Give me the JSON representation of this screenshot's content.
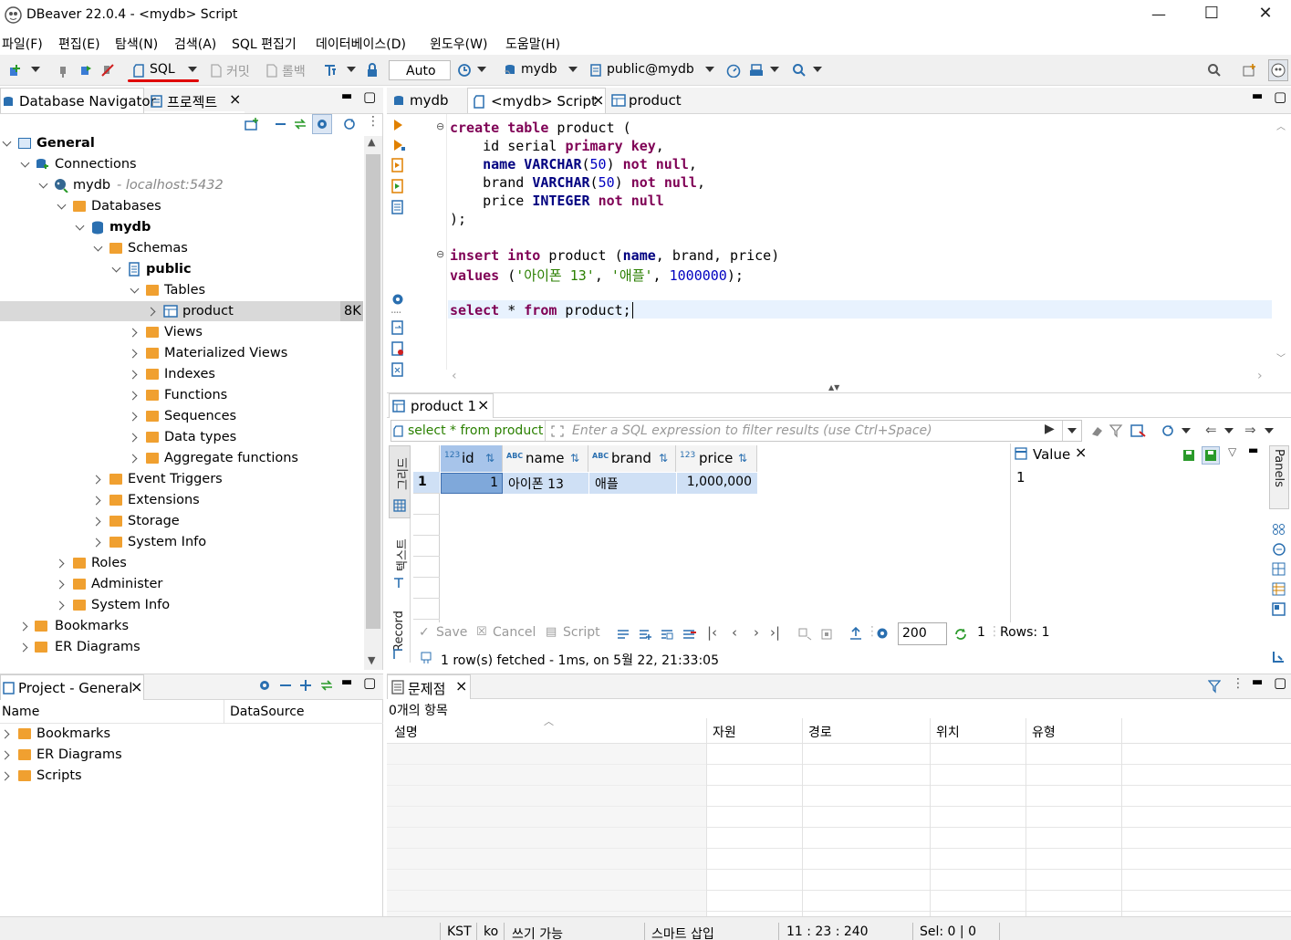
{
  "window": {
    "title": "DBeaver 22.0.4 - <mydb> Script"
  },
  "menu": [
    "파일(F)",
    "편집(E)",
    "탐색(N)",
    "검색(A)",
    "SQL 편집기",
    "데이터베이스(D)",
    "윈도우(W)",
    "도움말(H)"
  ],
  "toolbar": {
    "sql": "SQL",
    "commit": "커밋",
    "rollback": "롤백",
    "auto": "Auto",
    "connection": "mydb",
    "schema": "public@mydb"
  },
  "nav": {
    "tabs": [
      "Database Navigator",
      "프로젝트"
    ],
    "tree": [
      {
        "label": "General",
        "bold": true
      },
      {
        "label": "Connections"
      },
      {
        "label": "mydb",
        "hint": "- localhost:5432"
      },
      {
        "label": "Databases"
      },
      {
        "label": "mydb",
        "bold": true
      },
      {
        "label": "Schemas"
      },
      {
        "label": "public",
        "bold": true
      },
      {
        "label": "Tables"
      },
      {
        "label": "product",
        "size": "8K"
      },
      {
        "label": "Views"
      },
      {
        "label": "Materialized Views"
      },
      {
        "label": "Indexes"
      },
      {
        "label": "Functions"
      },
      {
        "label": "Sequences"
      },
      {
        "label": "Data types"
      },
      {
        "label": "Aggregate functions"
      },
      {
        "label": "Event Triggers"
      },
      {
        "label": "Extensions"
      },
      {
        "label": "Storage"
      },
      {
        "label": "System Info"
      },
      {
        "label": "Roles"
      },
      {
        "label": "Administer"
      },
      {
        "label": "System Info"
      },
      {
        "label": "Bookmarks"
      },
      {
        "label": "ER Diagrams"
      }
    ]
  },
  "project": {
    "title": "Project - General",
    "col_name": "Name",
    "col_ds": "DataSource",
    "items": [
      "Bookmarks",
      "ER Diagrams",
      "Scripts"
    ]
  },
  "editor": {
    "tabs": [
      "mydb",
      "<mydb> Script",
      "product"
    ],
    "lines": [
      {
        "t": "create table product (",
        "c": [
          [
            "kw",
            "create"
          ],
          [
            "",
            ""
          ],
          [
            "kw",
            "table"
          ],
          [
            "",
            "product ("
          ]
        ]
      },
      {
        "t": "    id serial primary key,"
      },
      {
        "t": "    name VARCHAR(50) not null,"
      },
      {
        "t": "    brand VARCHAR(50) not null,"
      },
      {
        "t": "    price INTEGER not null"
      },
      {
        "t": ");"
      },
      {
        "t": ""
      },
      {
        "t": "insert into product (name, brand, price)"
      },
      {
        "t": "values ('아이폰 13', '애플', 1000000);"
      },
      {
        "t": ""
      },
      {
        "t": "select * from product;"
      }
    ]
  },
  "results": {
    "tab": "product 1",
    "query": "select * from product",
    "filter_placeholder": "Enter a SQL expression to filter results (use Ctrl+Space)",
    "columns": [
      {
        "type": "123",
        "name": "id"
      },
      {
        "type": "ABC",
        "name": "name"
      },
      {
        "type": "ABC",
        "name": "brand"
      },
      {
        "type": "123",
        "name": "price"
      }
    ],
    "rows": [
      {
        "n": "1",
        "id": "1",
        "name": "아이폰 13",
        "brand": "애플",
        "price": "1,000,000"
      }
    ],
    "value_panel": {
      "title": "Value",
      "value": "1"
    },
    "side_tabs": [
      "그리드",
      "텍스트",
      "Record"
    ],
    "panels_tab": "Panels",
    "footer": {
      "save": "Save",
      "cancel": "Cancel",
      "script": "Script",
      "fetch_size": "200",
      "count": "1",
      "rows": "Rows: 1"
    },
    "status": "1 row(s) fetched - 1ms, on 5월 22, 21:33:05"
  },
  "problems": {
    "tab": "문제점",
    "count": "0개의 항목",
    "cols": [
      "설명",
      "자원",
      "경로",
      "위치",
      "유형"
    ]
  },
  "statusbar": {
    "tz": "KST",
    "lang": "ko",
    "mode": "쓰기 가능",
    "insert": "스마트 삽입",
    "pos": "11 : 23 : 240",
    "sel": "Sel: 0 | 0"
  }
}
